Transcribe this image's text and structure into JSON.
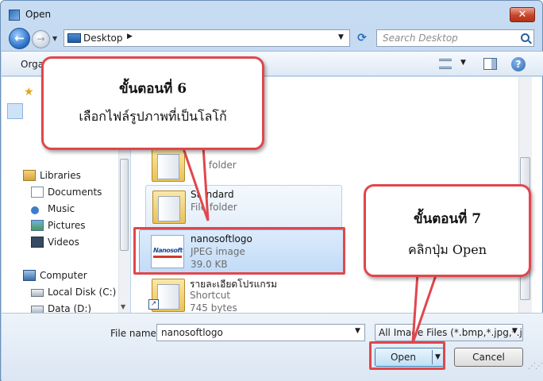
{
  "window": {
    "title": "Open",
    "close_label": "✕"
  },
  "nav": {
    "back": "←",
    "forward": "→",
    "location": "Desktop",
    "refresh": "⟳",
    "search_placeholder": "Search Desktop"
  },
  "toolbar": {
    "organize_label": "Orga"
  },
  "sidebar": {
    "items": [
      {
        "label": "Libraries",
        "icon": "library-icon"
      },
      {
        "label": "Documents",
        "icon": "documents-icon"
      },
      {
        "label": "Music",
        "icon": "music-icon"
      },
      {
        "label": "Pictures",
        "icon": "pictures-icon"
      },
      {
        "label": "Videos",
        "icon": "videos-icon"
      },
      {
        "label": "Computer",
        "icon": "computer-icon"
      },
      {
        "label": "Local Disk (C:)",
        "icon": "disk-icon"
      },
      {
        "label": "Data (D:)",
        "icon": "disk-icon"
      }
    ]
  },
  "files": [
    {
      "name": "",
      "type": "File folder",
      "size": "",
      "kind": "folder"
    },
    {
      "name": "Standard",
      "type": "File folder",
      "size": "",
      "kind": "folder"
    },
    {
      "name": "nanosoftlogo",
      "type": "JPEG image",
      "size": "39.0 KB",
      "kind": "image",
      "thumb_text": "Nanosoft"
    },
    {
      "name": "รายละเอียดโปรแกรม",
      "type": "Shortcut",
      "size": "745 bytes",
      "kind": "shortcut"
    }
  ],
  "bottom": {
    "file_name_label": "File name:",
    "file_name_value": "nanosoftlogo",
    "filter_label": "All Image Files (*.bmp,*.jpg,*.jp",
    "open_label": "Open",
    "cancel_label": "Cancel"
  },
  "callouts": [
    {
      "title": "ขั้นตอนที่ 6",
      "text": "เลือกไฟล์รูปภาพที่เป็นโลโก้"
    },
    {
      "title": "ขั้นตอนที่ 7",
      "text": "คลิกปุ่ม Open"
    }
  ],
  "colors": {
    "callout_border": "#e0474c",
    "title_bar": "#c7dcf2",
    "selection": "#c1dbf7"
  }
}
